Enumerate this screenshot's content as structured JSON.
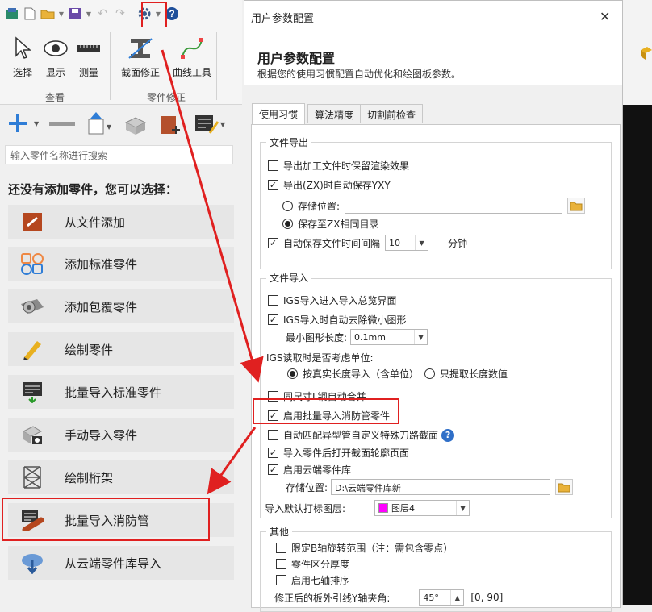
{
  "ribbon": {
    "buttons": [
      {
        "label": "选择",
        "icon": "cursor-icon"
      },
      {
        "label": "显示",
        "icon": "eye-icon"
      },
      {
        "label": "测量",
        "icon": "ruler-icon"
      },
      {
        "label": "截面修正",
        "icon": "section-icon"
      },
      {
        "label": "曲线工具",
        "icon": "curve-icon"
      }
    ],
    "groups": [
      "查看",
      "零件修正"
    ]
  },
  "search": {
    "placeholder": "输入零件名称进行搜索"
  },
  "hint": {
    "title": "还没有添加零件，您可以选择："
  },
  "part_buttons": [
    {
      "label": "从文件添加",
      "icon": "file-add-icon"
    },
    {
      "label": "添加标准零件",
      "icon": "standard-parts-icon"
    },
    {
      "label": "添加包覆零件",
      "icon": "wrap-part-icon"
    },
    {
      "label": "绘制零件",
      "icon": "pencil-icon"
    },
    {
      "label": "批量导入标准零件",
      "icon": "batch-import-icon"
    },
    {
      "label": "手动导入零件",
      "icon": "manual-import-icon"
    },
    {
      "label": "绘制桁架",
      "icon": "truss-icon"
    },
    {
      "label": "批量导入消防管",
      "icon": "fire-pipe-icon"
    },
    {
      "label": "从云端零件库导入",
      "icon": "cloud-download-icon"
    }
  ],
  "dialog": {
    "window_title": "用户参数配置",
    "heading": "用户参数配置",
    "subtitle": "根据您的使用习惯配置自动优化和绘图板参数。",
    "tabs": [
      "使用习惯",
      "算法精度",
      "切割前检查"
    ],
    "export_group": {
      "title": "文件导出",
      "keep_render": {
        "label": "导出加工文件时保留渲染效果",
        "checked": false
      },
      "auto_save_yxy": {
        "label": "导出(ZX)时自动保存YXY",
        "checked": true
      },
      "storage_location": {
        "label": "存储位置:",
        "value": "",
        "selected": false
      },
      "save_same_dir": {
        "label": "保存至ZX相同目录",
        "selected": true
      },
      "auto_save_interval": {
        "label": "自动保存文件时间间隔",
        "value": "10",
        "unit": "分钟",
        "checked": true
      }
    },
    "import_group": {
      "title": "文件导入",
      "igs_overview": {
        "label": "IGS导入进入导入总览界面",
        "checked": false
      },
      "igs_remove_small": {
        "label": "IGS导入时自动去除微小图形",
        "checked": true
      },
      "min_length": {
        "label": "最小图形长度:",
        "value": "0.1mm"
      },
      "igs_unit_question": "IGS读取时是否考虑单位:",
      "unit_real": {
        "label": "按真实长度导入（含单位）",
        "selected": true
      },
      "unit_value": {
        "label": "只提取长度数值",
        "selected": false
      },
      "merge_l_steel": {
        "label": "同尺寸L钢自动合并",
        "checked": false
      },
      "enable_fire_pipe": {
        "label": "启用批量导入消防管零件",
        "checked": true
      },
      "auto_match_pipe": {
        "label": "自动匹配异型管自定义特殊刀路截面",
        "checked": false
      },
      "open_section_page": {
        "label": "导入零件后打开截面轮廓页面",
        "checked": true
      },
      "enable_cloud": {
        "label": "启用云端零件库",
        "checked": true
      },
      "cloud_storage": {
        "label": "存储位置:",
        "value": "D:\\云端零件库新"
      },
      "default_layer": {
        "label": "导入默认打标图层:",
        "value": "图层4",
        "color": "#ff00ff"
      }
    },
    "other_group": {
      "title": "其他",
      "limit_b_axis": {
        "label": "限定B轴旋转范围（注：需包含零点）",
        "checked": false
      },
      "thickness": {
        "label": "零件区分厚度",
        "checked": false
      },
      "seven_axis": {
        "label": "启用七轴排序",
        "checked": false
      },
      "angle": {
        "label": "修正后的板外引线Y轴夹角:",
        "value": "45°",
        "range": "[0, 90]"
      }
    }
  },
  "colors": {
    "accent_red": "#e02020",
    "highlight_blue": "#2f6fc8"
  }
}
